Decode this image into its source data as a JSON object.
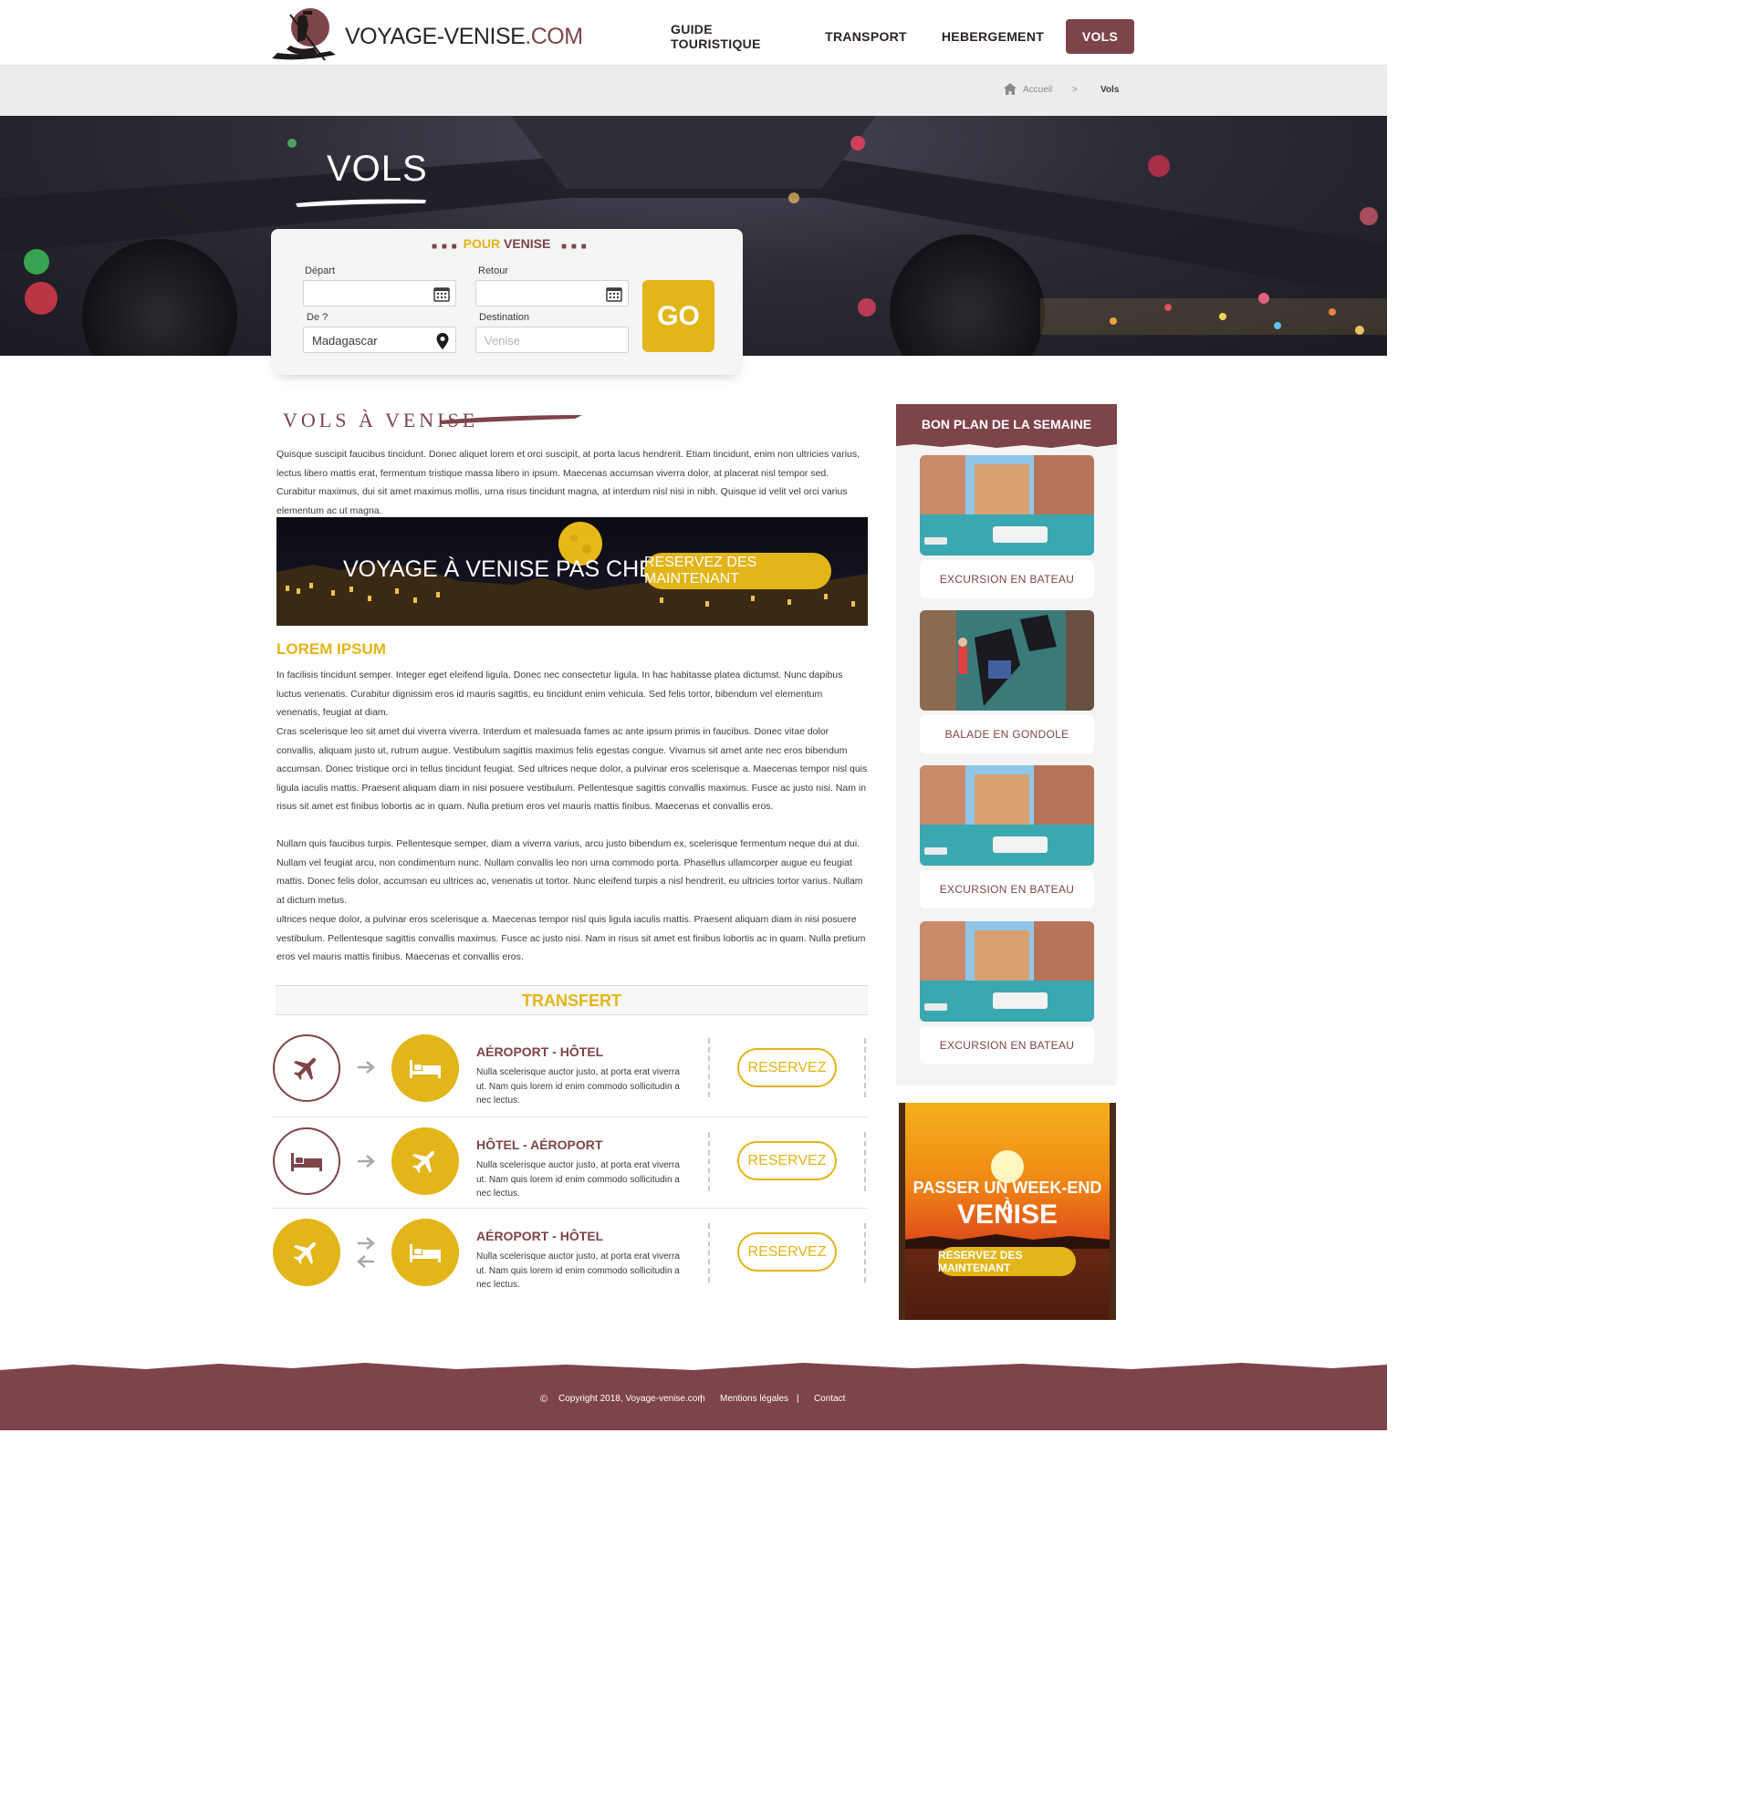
{
  "header": {
    "logo_main": "VOYAGE-VENISE",
    "logo_tld": ".COM",
    "nav": [
      {
        "label": "GUIDE TOURISTIQUE"
      },
      {
        "label": "TRANSPORT"
      },
      {
        "label": "HEBERGEMENT"
      },
      {
        "label": "VOLS",
        "active": true
      }
    ]
  },
  "breadcrumb": {
    "home": "Accueil",
    "separator": ">",
    "current": "Vols"
  },
  "hero": {
    "title": "VOLS"
  },
  "search": {
    "title_highlight": "POUR",
    "title_rest": "VENISE",
    "depart_label": "Départ",
    "depart_value": "",
    "retour_label": "Retour",
    "retour_value": "",
    "from_label": "De ?",
    "from_value": "Madagascar",
    "destination_label": "Destination",
    "destination_placeholder": "Venise",
    "go_label": "GO"
  },
  "main": {
    "heading": "VOLS À VENISE",
    "intro": "Quisque suscipit faucibus tincidunt. Donec aliquet lorem et orci suscipit, at porta lacus hendrerit. Etiam tincidunt, enim non ultricies varius, lectus libero mattis erat, fermentum tristique massa libero in ipsum. Maecenas accumsan viverra dolor, at placerat nisl tempor sed. Curabitur maximus, dui sit amet maximus mollis, urna risus tincidunt magna, at interdum nisl nisi in nibh. Quisque id velit vel orci varius elementum ac ut magna.",
    "banner": {
      "text": "VOYAGE À VENISE PAS CHER",
      "button": "RESERVEZ DES MAINTENANT"
    },
    "subheading": "LOREM IPSUM",
    "paragraphs": [
      "In facilisis tincidunt semper. Integer eget eleifend ligula. Donec nec consectetur ligula. In hac habitasse platea dictumst. Nunc dapibus luctus venenatis. Curabitur dignissim eros id mauris sagittis, eu tincidunt enim vehicula. Sed felis tortor, bibendum vel elementum venenatis, feugiat at diam.",
      "Cras scelerisque leo sit amet dui viverra viverra. Interdum et malesuada fames ac ante ipsum primis in faucibus. Donec vitae dolor convallis, aliquam justo ut, rutrum augue. Vestibulum sagittis maximus felis egestas congue. Vivamus sit amet ante nec eros bibendum accumsan. Donec tristique orci in tellus tincidunt feugiat. Sed ultrices neque dolor, a pulvinar eros scelerisque a. Maecenas tempor nisl quis ligula iaculis mattis. Praesent aliquam diam in nisi posuere vestibulum. Pellentesque sagittis convallis maximus. Fusce ac justo nisi. Nam in risus sit amet est finibus lobortis ac in quam. Nulla pretium eros vel mauris mattis finibus. Maecenas et convallis eros.",
      "Nullam quis faucibus turpis. Pellentesque semper, diam a viverra varius, arcu justo bibendum ex, scelerisque fermentum neque dui at dui. Nullam vel feugiat arcu, non condimentum nunc. Nullam convallis leo non urna commodo porta. Phasellus ullamcorper augue eu feugiat mattis. Donec felis dolor, accumsan eu ultrices ac, venenatis ut tortor. Nunc eleifend turpis a nisl hendrerit, eu ultricies tortor varius. Nullam at dictum metus.",
      "ultrices neque dolor, a pulvinar eros scelerisque a. Maecenas tempor nisl quis ligula iaculis mattis. Praesent aliquam diam in nisi posuere vestibulum. Pellentesque sagittis convallis maximus. Fusce ac justo nisi. Nam in risus sit amet est finibus lobortis ac in quam. Nulla pretium eros vel mauris mattis finibus. Maecenas et convallis eros."
    ],
    "transfer": {
      "heading": "TRANSFERT",
      "rows": [
        {
          "title": "AÉROPORT - HÔTEL",
          "desc": "Nulla scelerisque auctor justo, at porta erat viverra ut. Nam quis lorem id enim commodo sollicitudin a nec lectus.",
          "button": "RESERVEZ",
          "from_icon": "plane-icon",
          "to_icon": "bed-icon"
        },
        {
          "title": "HÔTEL - AÉROPORT",
          "desc": "Nulla scelerisque auctor justo, at porta erat viverra ut. Nam quis lorem id enim commodo sollicitudin a nec lectus.",
          "button": "RESERVEZ",
          "from_icon": "bed-icon",
          "to_icon": "plane-icon"
        },
        {
          "title": "AÉROPORT - HÔTEL",
          "desc": "Nulla scelerisque auctor justo, at porta erat viverra ut. Nam quis lorem id enim commodo sollicitudin a nec lectus.",
          "button": "RESERVEZ",
          "from_icon": "plane-icon",
          "to_icon": "bed-icon"
        }
      ]
    }
  },
  "sidebar": {
    "heading": "BON PLAN DE LA SEMAINE",
    "cards": [
      {
        "label": "EXCURSION EN BATEAU"
      },
      {
        "label": "BALADE EN GONDOLE"
      },
      {
        "label": "EXCURSION EN BATEAU"
      },
      {
        "label": "EXCURSION EN BATEAU"
      }
    ],
    "promo": {
      "line1": "PASSER UN WEEK-END À",
      "line2": "VENISE",
      "button": "RESERVEZ DES MAINTENANT"
    }
  },
  "footer": {
    "copyright": "Copyright 2018, Voyage-venise.com",
    "sep": "|",
    "legal": "Mentions légales",
    "contact": "Contact"
  },
  "colors": {
    "brand": "#7d4449",
    "accent": "#e2b518",
    "light_bg": "#ececec"
  }
}
